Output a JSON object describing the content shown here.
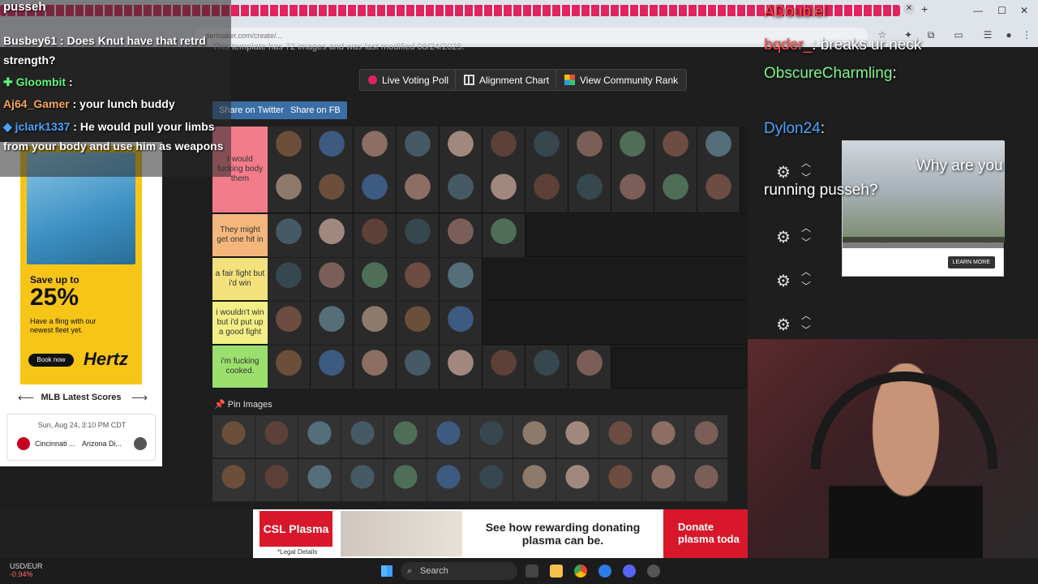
{
  "browser": {
    "address_text": "tiermaker.com/create/...",
    "tab_close": "✕",
    "tab_add": "+",
    "controls": [
      "—",
      "☐",
      "✕"
    ]
  },
  "page": {
    "modified_text": "This template has 72 images and was last modified 08/24/2025.",
    "buttons": {
      "live_voting": "Live Voting Poll",
      "alignment": "Alignment Chart",
      "community_rank": "View Community Rank"
    },
    "share_twitter": "Share on Twitter",
    "share_fb": "Share on FB",
    "tiers": [
      {
        "label": "I would fucking body them",
        "color": "#f27c8a",
        "count": 22
      },
      {
        "label": "They might get one hit in",
        "color": "#f4b77b",
        "count": 6
      },
      {
        "label": "a fair fight but i'd win",
        "color": "#f3e27c",
        "count": 5
      },
      {
        "label": "i wouldn't win but i'd put up a good fight",
        "color": "#f3ef84",
        "count": 5
      },
      {
        "label": "i'm fucking cooked.",
        "color": "#9be06c",
        "count": 8
      }
    ],
    "pin_title": "Pin Images"
  },
  "chat_left": [
    {
      "user": "Busbey61",
      "color": "#ffffff",
      "msg": "Does Knut have that retrd strength?"
    },
    {
      "user": "Gloombit",
      "color": "#5ef57a",
      "msg": ""
    },
    {
      "user": "Aj64_Gamer",
      "color": "#f5a35a",
      "msg": "your lunch buddy"
    },
    {
      "user": "jclark1337",
      "color": "#4aa3ff",
      "msg": "He would pull your limbs from your body and use him as weapons"
    }
  ],
  "chat_top_fragment": "pusseh",
  "ad": {
    "save_text": "Save up to",
    "pct": "25%",
    "sub": "Have a fling with our newest fleet yet.",
    "book": "Book now",
    "brand": "Hertz"
  },
  "mlb": {
    "title": "MLB Latest Scores",
    "left_arrow": "⟵",
    "right_arrow": "⟶",
    "date": "Sun, Aug 24, 3:10 PM CDT",
    "team1": "Cincinnati ...",
    "team2": "Arizona Di..."
  },
  "chat_right": [
    {
      "user": "ADoublel",
      "color": "#ff4d4d"
    },
    {
      "user": "bqder_",
      "color": "#ff4d4d",
      "msg": "breaks ur neck"
    },
    {
      "user": "ObscureCharmling",
      "color": "#7cf58a"
    },
    {
      "user": "Dylon24",
      "color": "#4aa3ff"
    },
    {
      "msg": "Why are you running pusseh?"
    }
  ],
  "video_ad": {
    "learn": "LEARN MORE"
  },
  "bottom_ad": {
    "brand": "CSL Plasma",
    "legal": "*Legal Details",
    "headline": "See how rewarding donating plasma can be.",
    "donate": "Donate plasma toda"
  },
  "taskbar": {
    "ticker_label": "USD/EUR",
    "ticker_value": "-0.94%",
    "search": "Search"
  },
  "colors": {
    "accent_red": "#e0245e",
    "share_blue": "#3b6ea5"
  }
}
